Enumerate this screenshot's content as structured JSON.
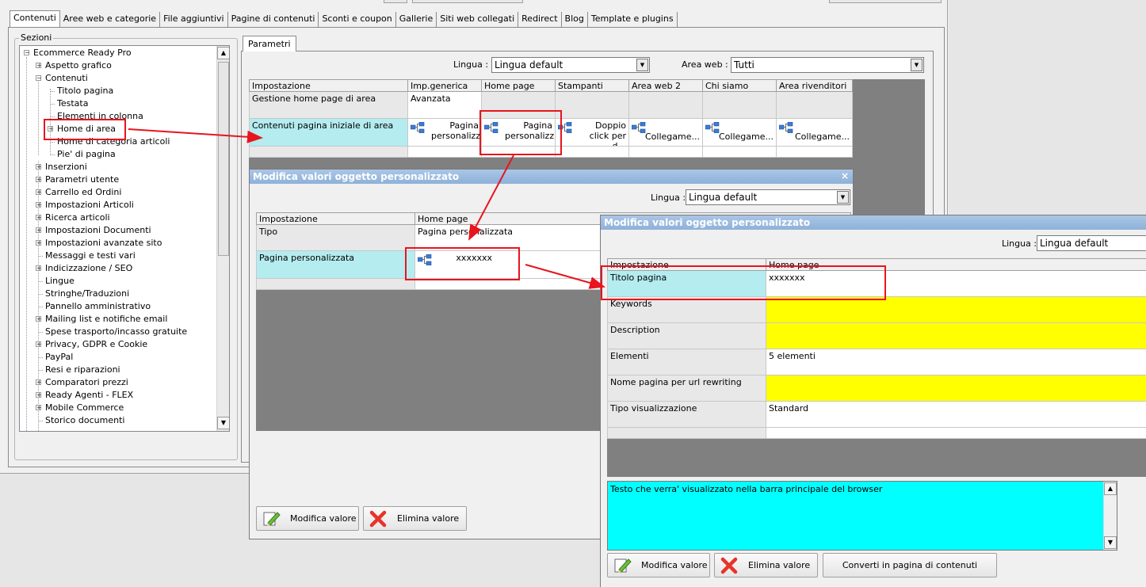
{
  "main_tabs": [
    "Contenuti",
    "Aree web e categorie",
    "File aggiuntivi",
    "Pagine di contenuti",
    "Sconti e coupon",
    "Gallerie",
    "Siti web collegati",
    "Redirect",
    "Blog",
    "Template e plugins"
  ],
  "sections_label": "Sezioni",
  "tree": {
    "root": "Ecommerce Ready Pro",
    "aspetto": "Aspetto grafico",
    "contenuti": "Contenuti",
    "titolo_pagina": "Titolo pagina",
    "testata": "Testata",
    "elementi_colonna": "Elementi in colonna",
    "home_area": "Home di area",
    "home_categoria": "Home di categoria articoli",
    "pie_pagina": "Pie' di pagina",
    "items": [
      "Inserzioni",
      "Parametri utente",
      "Carrello ed Ordini",
      "Impostazioni Articoli",
      "Ricerca articoli",
      "Impostazioni Documenti",
      "Impostazioni avanzate sito",
      "Messaggi e testi vari",
      "Indicizzazione / SEO",
      "Lingue",
      "Stringhe/Traduzioni",
      "Pannello amministrativo",
      "Mailing list e notifiche email",
      "Spese trasporto/incasso gratuite",
      "Privacy, GDPR e Cookie",
      "PayPal",
      "Resi e riparazioni",
      "Comparatori prezzi",
      "Ready Agenti - FLEX",
      "Mobile Commerce",
      "Storico documenti"
    ]
  },
  "params_tab": "Parametri",
  "lingua_label": "Lingua :",
  "lingua_value": "Lingua default",
  "area_label": "Area web :",
  "area_value": "Tutti",
  "grid": {
    "headers": [
      "Impostazione",
      "Imp.generica",
      "Home page",
      "Stampanti",
      "Area web 2",
      "Chi siamo",
      "Area rivenditori"
    ],
    "row1": {
      "label": "Gestione home page di area",
      "value": "Avanzata"
    },
    "row2": {
      "label": "Contenuti pagina iniziale di area",
      "cells": [
        "Pagina personalizz...",
        "Pagina personalizz...",
        "Doppio click per d...",
        "Collegame...",
        "Collegame...",
        "Collegame..."
      ]
    }
  },
  "dialog1": {
    "title": "Modifica valori oggetto personalizzato",
    "lingua_label": "Lingua :",
    "lingua_value": "Lingua default",
    "headers": [
      "Impostazione",
      "Home page"
    ],
    "rows": [
      {
        "label": "Tipo",
        "value": "Pagina personalizzata"
      },
      {
        "label": "Pagina personalizzata",
        "value": "xxxxxxx"
      }
    ],
    "btn_edit": "Modifica valore",
    "btn_delete": "Elimina valore"
  },
  "dialog2": {
    "title": "Modifica valori oggetto personalizzato",
    "lingua_label": "Lingua :",
    "lingua_value": "Lingua default",
    "headers": [
      "Impostazione",
      "Home page"
    ],
    "rows": [
      {
        "label": "Titolo pagina",
        "value": "xxxxxxx"
      },
      {
        "label": "Keywords",
        "value": ""
      },
      {
        "label": "Description",
        "value": ""
      },
      {
        "label": "Elementi",
        "value": "5 elementi"
      },
      {
        "label": "Nome pagina per url rewriting",
        "value": ""
      },
      {
        "label": "Tipo visualizzazione",
        "value": "Standard"
      }
    ],
    "memo": "Testo che verra' visualizzato nella barra principale del browser",
    "btn_edit": "Modifica valore",
    "btn_delete": "Elimina valore",
    "btn_convert": "Converti in pagina di contenuti"
  },
  "colors": {
    "highlight_red": "#e8141e",
    "cyan_selected": "#b4ecf0",
    "required_yellow": "#ffff00",
    "memo_cyan": "#00ffff"
  }
}
